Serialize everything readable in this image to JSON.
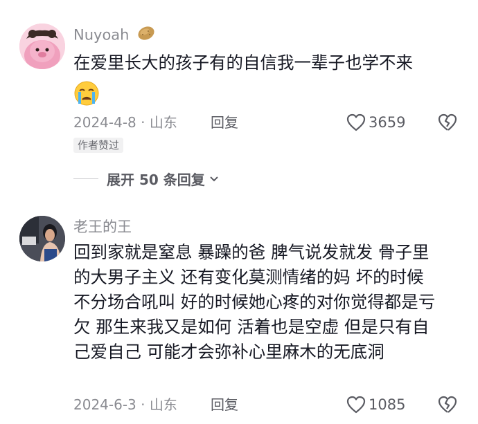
{
  "comments": [
    {
      "username": "Nuyoah",
      "username_emoji": "potato-icon",
      "text": "在爱里长大的孩子有的自信我一辈子也学不来",
      "emoji": "crying-face-icon",
      "date_location": "2024-4-8 · 山东",
      "reply_label": "回复",
      "likes": "3659",
      "author_badge": "作者赞过",
      "expand_label": "展开 50 条回复"
    },
    {
      "username": "老王的王",
      "lines": [
        "回到家就是窒息 暴躁的爸 脾气说发就发 骨子里",
        "的大男子主义 还有变化莫测情绪的妈 坏的时候",
        "不分场合吼叫 好的时候她心疼的对你觉得都是亏",
        "欠 那生来我又是如何 活着也是空虚 但是只有自",
        "己爱自己 可能才会弥补心里麻木的无底洞"
      ],
      "date_location": "2024-6-3 · 山东",
      "reply_label": "回复",
      "likes": "1085"
    }
  ],
  "colors": {
    "text_primary": "#161823",
    "text_secondary": "#8a8b91",
    "avatar1_bg": "#f7c6d8",
    "avatar2_bg": "#3a3d4a"
  }
}
